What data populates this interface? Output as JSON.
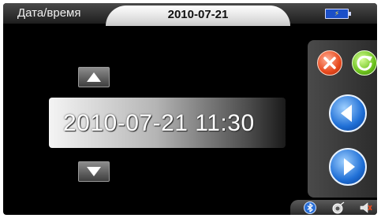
{
  "header": {
    "title": "Дата/время",
    "date": "2010-07-21"
  },
  "main": {
    "datetime": "2010-07-21 11:30"
  },
  "icons": {
    "up": "arrow-up-icon",
    "down": "arrow-down-icon",
    "close": "close-icon",
    "refresh": "refresh-icon",
    "prev": "chevron-left-icon",
    "next": "chevron-right-icon",
    "battery": "battery-icon",
    "bluetooth": "bluetooth-icon",
    "gps": "gps-icon",
    "volume": "volume-icon"
  },
  "colors": {
    "background": "#000000",
    "accent_blue": "#1f6fd6",
    "close_red": "#e8491d",
    "refresh_green": "#6cc21d"
  }
}
